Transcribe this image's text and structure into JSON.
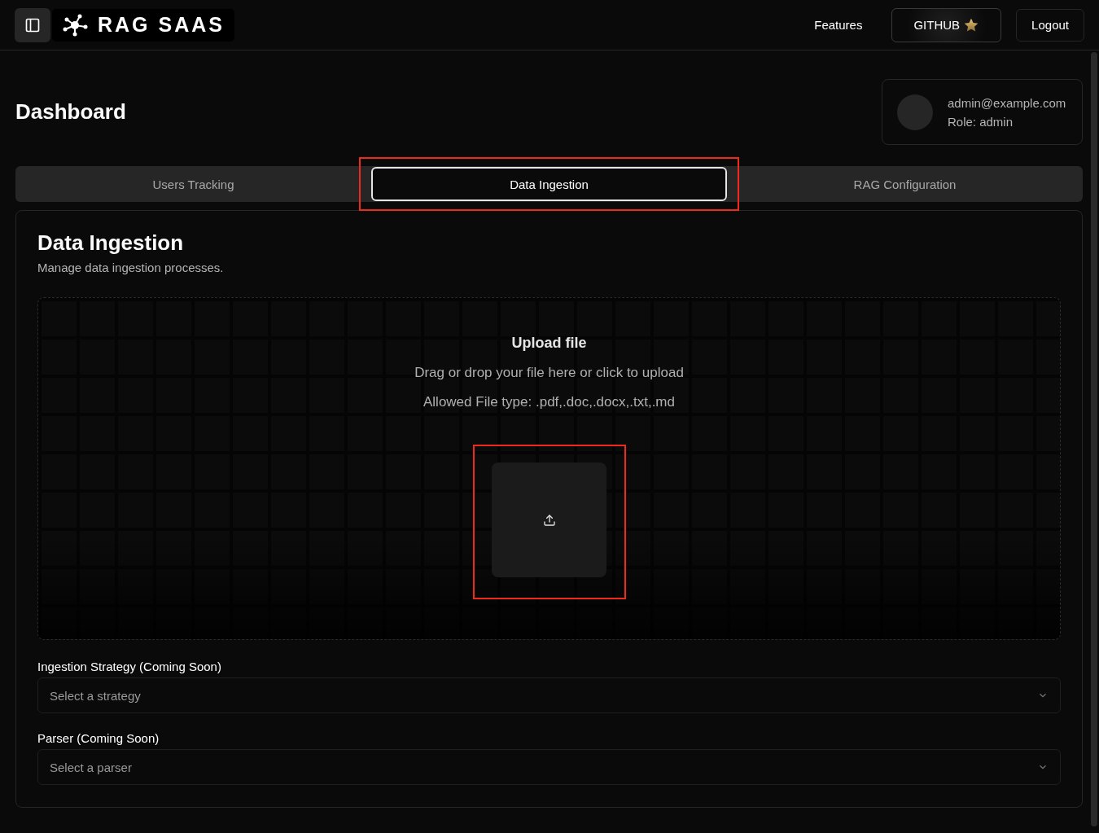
{
  "header": {
    "logo": "RAG SAAS",
    "nav": [
      {
        "label": "Features",
        "kind": "link"
      },
      {
        "label": "GITHUB",
        "kind": "star-button"
      },
      {
        "label": "Logout",
        "kind": "button"
      }
    ]
  },
  "page_title": "Dashboard",
  "profile": {
    "email": "admin@example.com",
    "role": "Role: admin"
  },
  "tabs": [
    {
      "label": "Users Tracking",
      "selected": false,
      "highlighted": false
    },
    {
      "label": "Data Ingestion",
      "selected": true,
      "highlighted": true
    },
    {
      "label": "RAG Configuration",
      "selected": false,
      "highlighted": false
    }
  ],
  "panel": {
    "title": "Data Ingestion",
    "description": "Manage data ingestion processes.",
    "upload": {
      "title": "Upload file",
      "hint": "Drag or drop your file here or click to upload",
      "allowed": "Allowed File type: .pdf,.doc,.docx,.txt,.md",
      "highlighted": true
    },
    "selects": [
      {
        "label": "Ingestion Strategy (Coming Soon)",
        "placeholder": "Select a strategy"
      },
      {
        "label": "Parser (Coming Soon)",
        "placeholder": "Select a parser"
      }
    ]
  }
}
